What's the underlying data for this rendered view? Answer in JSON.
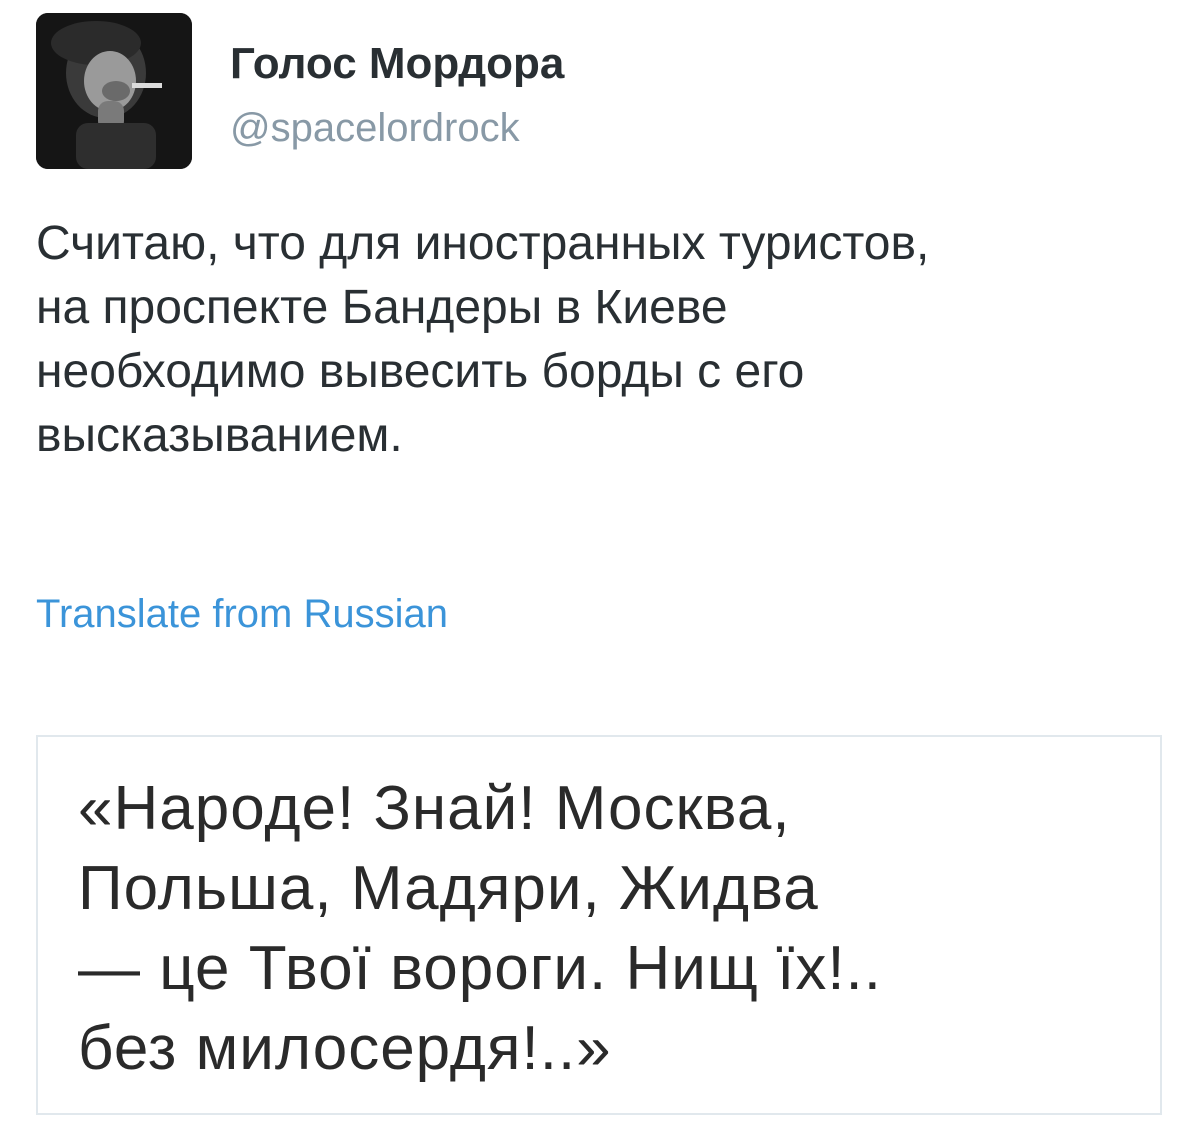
{
  "author": {
    "display_name": "Голос Мордора",
    "handle": "@spacelordrock",
    "avatar_icon": "profile-photo"
  },
  "tweet": {
    "lines": [
      "Считаю, что для иностранных туристов,",
      "на проспекте Бандеры в Киеве",
      "необходимо вывесить борды с его",
      "высказыванием."
    ],
    "translate_label": "Translate from Russian"
  },
  "media": {
    "quote_lines": [
      "«Народе! Знай! Москва,",
      "Польша, Мадяри, Жидва",
      "— це Твої вороги. Нищ їх!..",
      "без милосердя!..»"
    ]
  },
  "colors": {
    "text": "#292f33",
    "secondary": "#8899a6",
    "link": "#3b94d9",
    "border": "#e1e8ed"
  }
}
